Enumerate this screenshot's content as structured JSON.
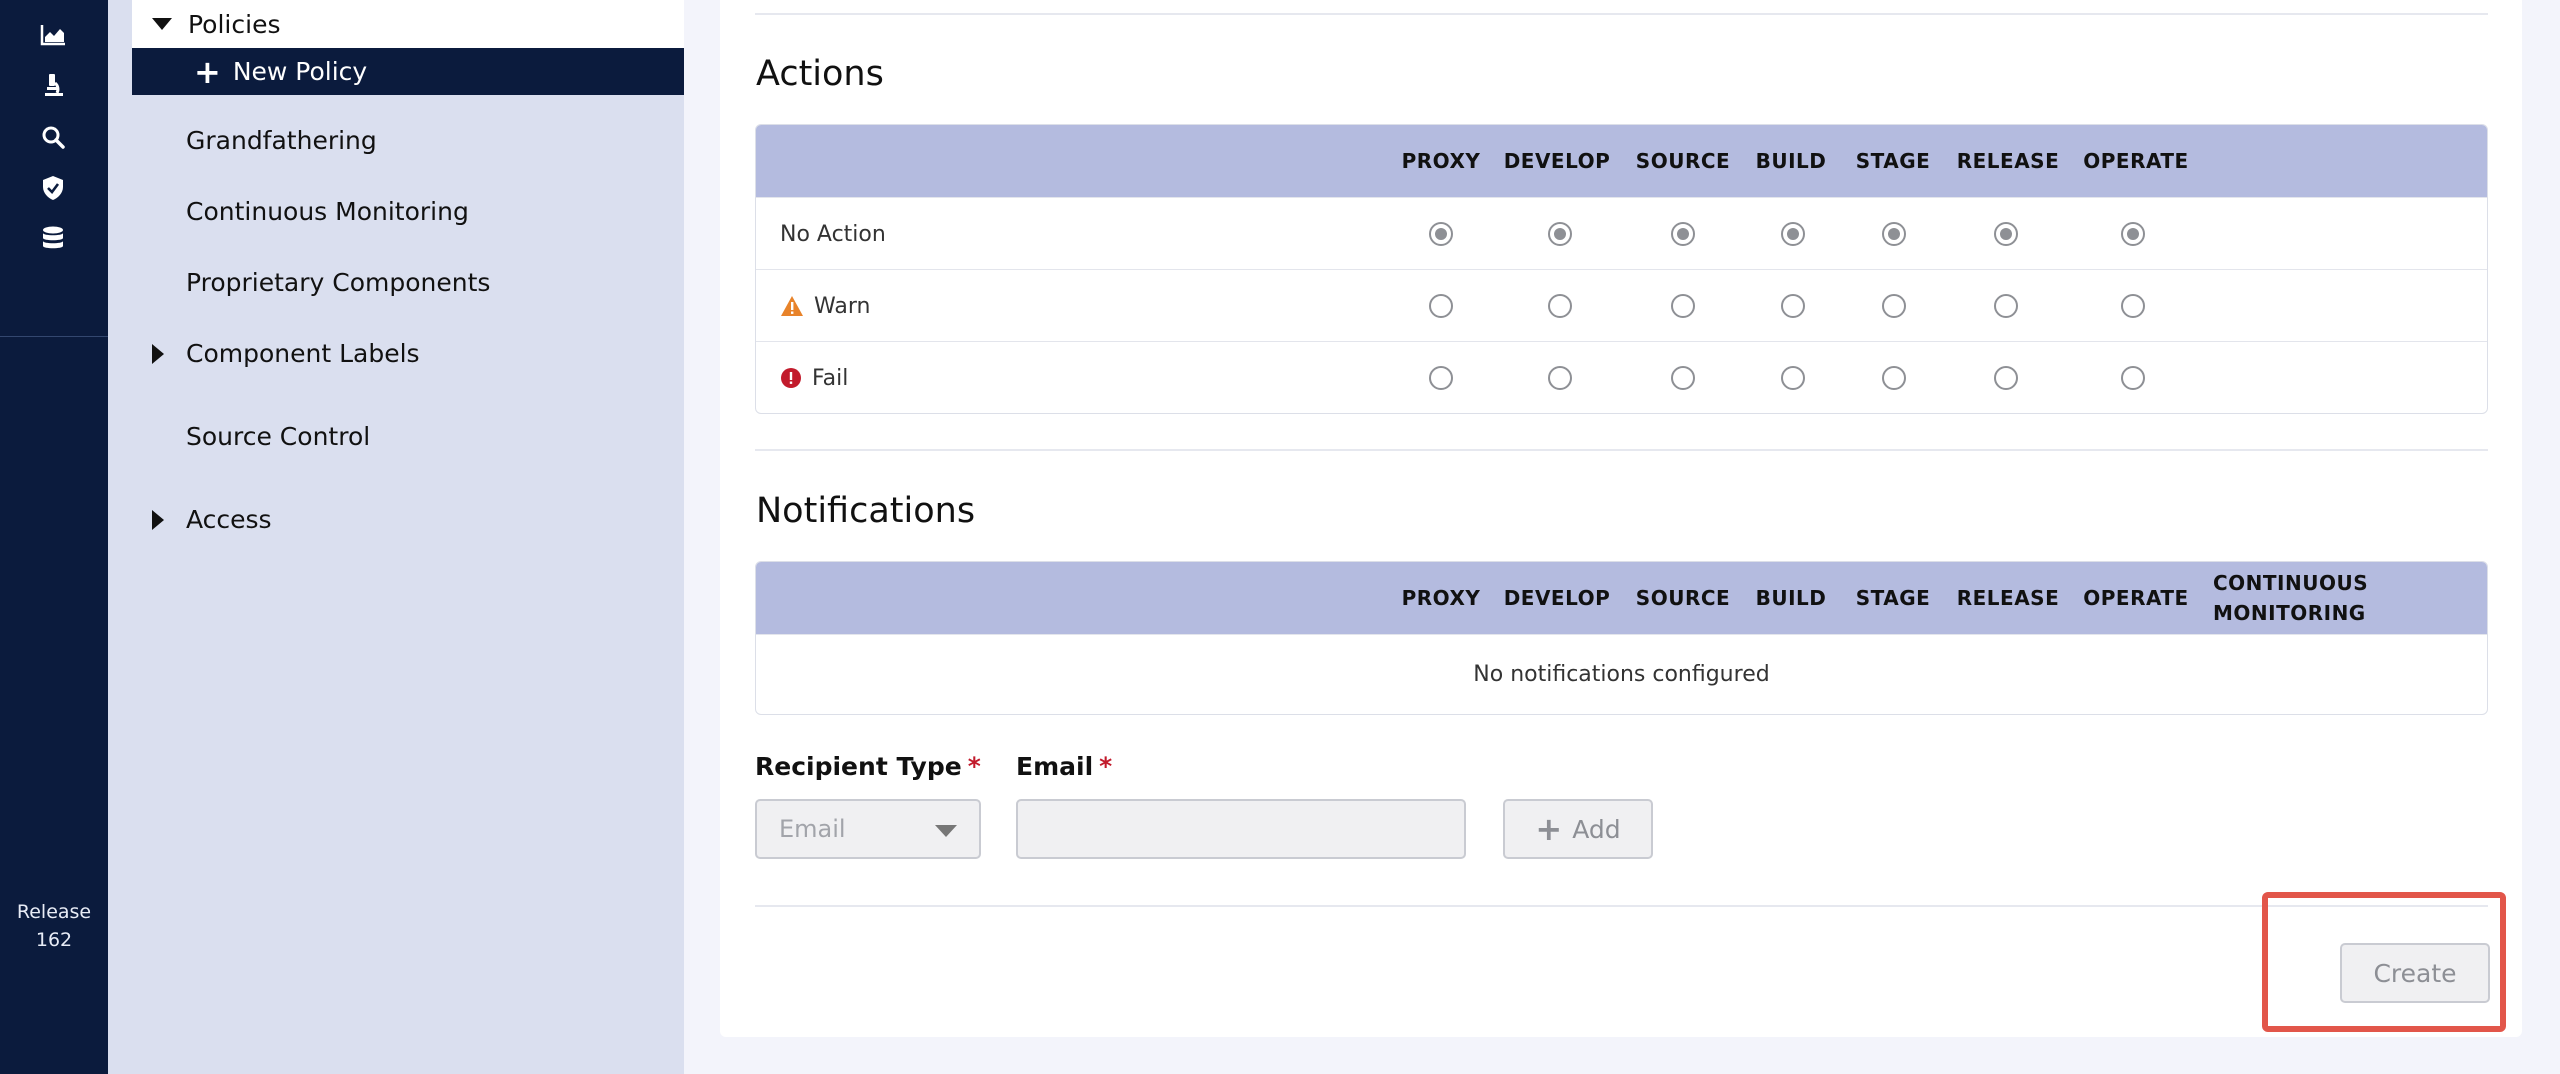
{
  "rail": {
    "icons": [
      "chart-icon",
      "microscope-icon",
      "search-icon",
      "shield-check-icon",
      "database-icon"
    ],
    "release_line1": "Release",
    "release_line2": "162"
  },
  "sidebar": {
    "policies_label": "Policies",
    "new_policy_label": "New Policy",
    "items": [
      {
        "label": "Grandfathering"
      },
      {
        "label": "Continuous Monitoring"
      },
      {
        "label": "Proprietary Components"
      },
      {
        "label": "Component Labels"
      },
      {
        "label": "Source Control"
      },
      {
        "label": "Access"
      }
    ]
  },
  "actions": {
    "title": "Actions",
    "columns": [
      "PROXY",
      "DEVELOP",
      "SOURCE",
      "BUILD",
      "STAGE",
      "RELEASE",
      "OPERATE"
    ],
    "rows": [
      {
        "label": "No Action",
        "icon": "none",
        "checked": true
      },
      {
        "label": "Warn",
        "icon": "warning-triangle-icon",
        "checked": false
      },
      {
        "label": "Fail",
        "icon": "error-circle-icon",
        "checked": false
      }
    ]
  },
  "notifications": {
    "title": "Notifications",
    "columns": [
      "PROXY",
      "DEVELOP",
      "SOURCE",
      "BUILD",
      "STAGE",
      "RELEASE",
      "OPERATE"
    ],
    "continuous_line1": "CONTINUOUS",
    "continuous_line2": "MONITORING",
    "empty_text": "No notifications configured"
  },
  "form": {
    "recipient_type_label": "Recipient Type",
    "required_mark": "*",
    "email_label": "Email",
    "recipient_type_value": "Email",
    "email_value": "",
    "add_label": "Add",
    "create_label": "Create"
  },
  "colors": {
    "rail_bg": "#0b1b3d",
    "sidebar_bg": "#dadfef",
    "table_header_bg": "#b4bbdf",
    "warning": "#e8832a",
    "error": "#c21b2c",
    "highlight": "#e2564a"
  }
}
